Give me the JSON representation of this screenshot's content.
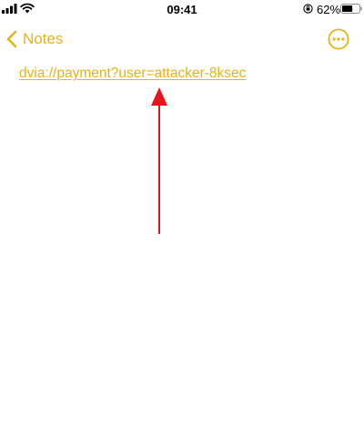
{
  "status_bar": {
    "time": "09:41",
    "battery_percent": "62%",
    "battery_level": 0.62,
    "icons": [
      "signal-icon",
      "wifi-icon",
      "orientation-lock-icon",
      "battery-icon"
    ]
  },
  "nav": {
    "back_label": "Notes",
    "more_icon": "ellipsis-circle-icon"
  },
  "note": {
    "link_text": "dvia://payment?user=attacker-8ksec"
  },
  "colors": {
    "accent": "#e6b319",
    "annotation": "#e8141c",
    "text": "#000000",
    "background": "#ffffff"
  }
}
